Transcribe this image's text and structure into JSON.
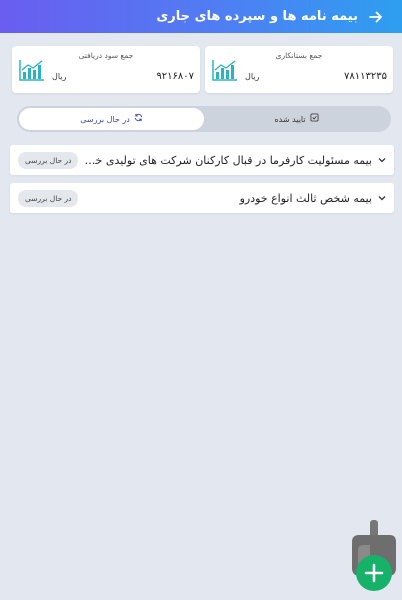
{
  "header": {
    "title": "بیمه نامه ها و سپرده های جاری",
    "back_icon": "arrow-right-icon"
  },
  "cards": [
    {
      "title": "جمع بستانکاری",
      "value": "۷۸۱۱۳۲۳۵",
      "unit": "ریال",
      "icon": "chart-icon"
    },
    {
      "title": "جمع سود دریافتی",
      "value": "۹۲۱۶۸۰۷",
      "unit": "ریال",
      "icon": "chart-icon"
    }
  ],
  "tabs": [
    {
      "label": "تایید شده",
      "icon": "check-square-icon",
      "active": false
    },
    {
      "label": "در حال بررسی",
      "icon": "refresh-icon",
      "active": true
    }
  ],
  "items": [
    {
      "title": "بیمه مسئولیت کارفرما در قبال کارکنان شرکت های تولیدی خدما...",
      "status": "در حال بررسی"
    },
    {
      "title": "بیمه شخص ثالث انواع خودرو",
      "status": "در حال بررسی"
    }
  ],
  "colors": {
    "header_start": "#6a5df0",
    "header_end": "#2d9ff0",
    "icon_teal": "#2bb3c0",
    "active_tab_text": "#3d4aa8",
    "background": "#e3e7ef"
  }
}
